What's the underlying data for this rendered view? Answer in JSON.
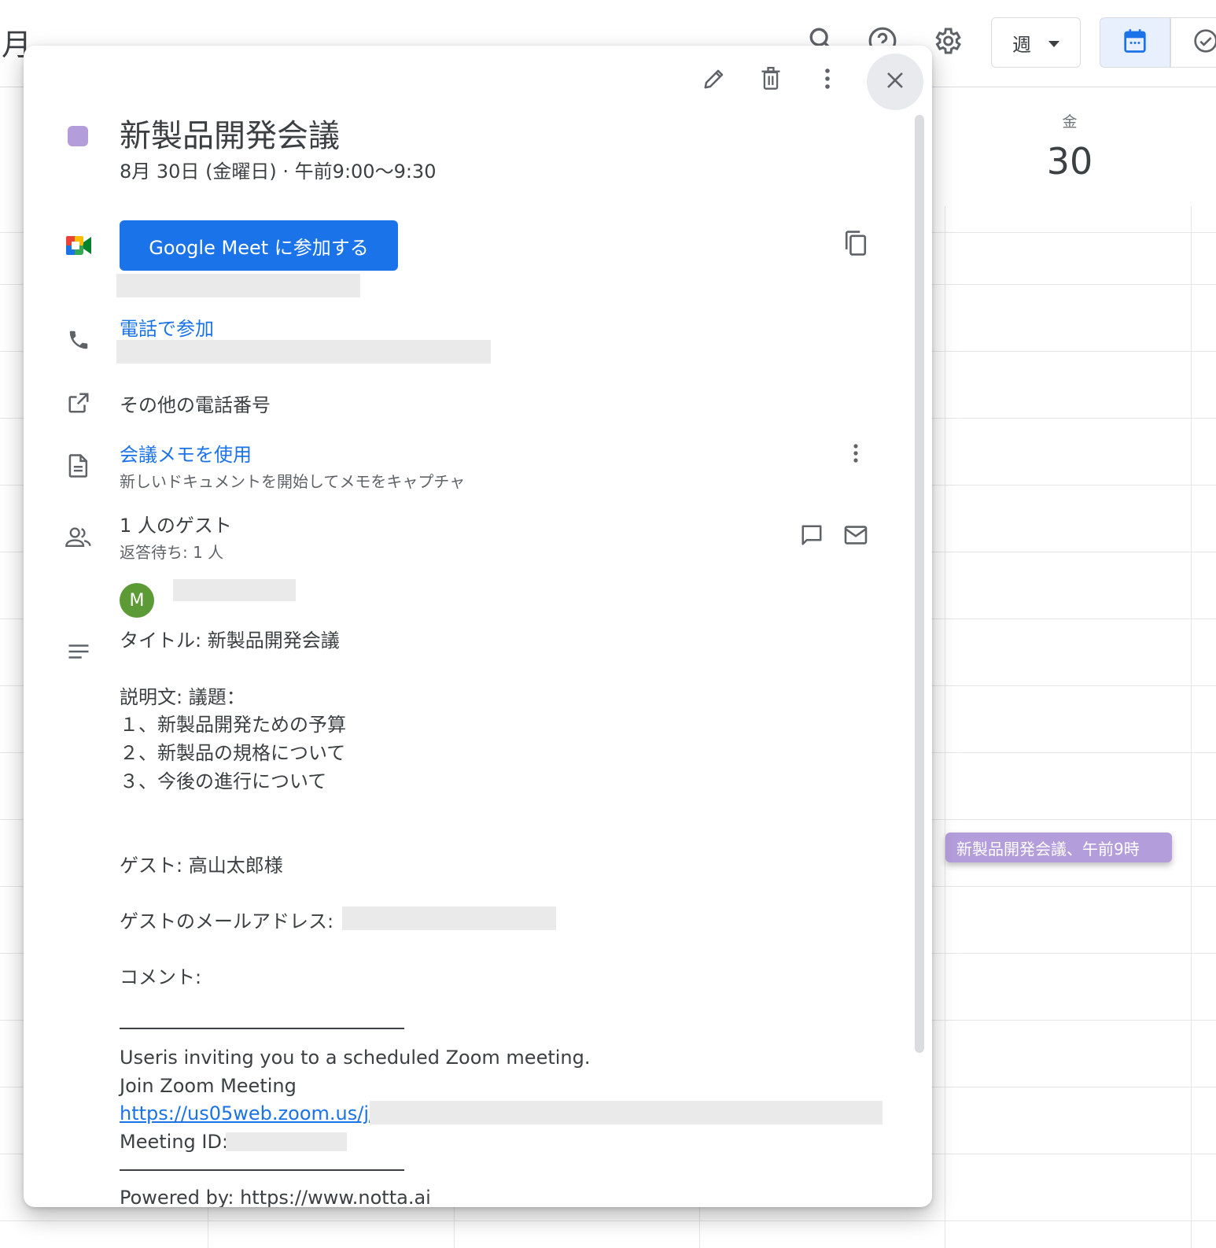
{
  "background": {
    "month_fragment": "月",
    "view_select_label": "週",
    "day_name": "金",
    "day_number": "30",
    "event_chip": "新製品開発会議、午前9時"
  },
  "event": {
    "title": "新製品開発会議",
    "datetime": "8月 30日 (金曜日)  ·  午前9:00〜9:30",
    "color": "#b39ddb",
    "meet_button": "Google Meet に参加する",
    "phone_join": "電話で参加",
    "more_numbers": "その他の電話番号",
    "notes_title": "会議メモを使用",
    "notes_subtitle": "新しいドキュメントを開始してメモをキャプチャ",
    "guests_title": "1 人のゲスト",
    "guests_subtitle": "返答待ち: 1 人",
    "guest_avatar_letter": "M",
    "guest_avatar_color": "#5c9a35"
  },
  "description": {
    "line_title": "タイトル: 新製品開発会議",
    "line_desc_head": "説明文: 議題：",
    "agenda": [
      "１、新製品開発ための予算",
      "２、新製品の規格について",
      "３、今後の進行について"
    ],
    "line_guest": "ゲスト: 高山太郎様",
    "line_email": "ゲストのメールアドレス:",
    "line_comment": "コメント:",
    "zoom_invite": "Useris inviting you to a scheduled Zoom meeting.",
    "zoom_join": "Join Zoom Meeting",
    "zoom_url": "https://us05web.zoom.us/j/",
    "meeting_id_label": "Meeting ID:",
    "powered_by_partial": "Powered by: https://www.notta.ai"
  },
  "colors": {
    "accent": "#1a73e8",
    "text": "#3c4043"
  }
}
